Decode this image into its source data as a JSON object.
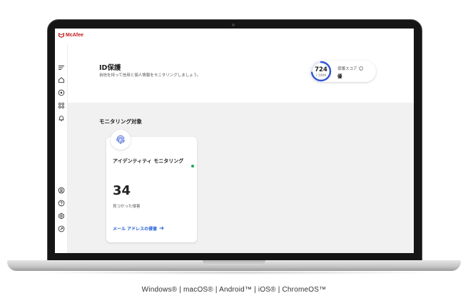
{
  "app": {
    "brand": "McAfee",
    "brand_color": "#c01818"
  },
  "sidebar": {
    "items": [
      {
        "icon": "menu-icon"
      },
      {
        "icon": "home-icon"
      },
      {
        "icon": "scan-icon"
      },
      {
        "icon": "apps-icon"
      },
      {
        "icon": "bell-icon"
      },
      {
        "icon": "account-icon"
      },
      {
        "icon": "help-icon"
      },
      {
        "icon": "settings-icon"
      },
      {
        "icon": "feedback-icon"
      }
    ]
  },
  "header": {
    "title": "ID保護",
    "subtitle": "自信を持って信用と個人情報をモニタリングしましょう。"
  },
  "score": {
    "value": "724",
    "max": "/ 1000",
    "fraction": 0.724,
    "label": "保護スコア",
    "rating": "優",
    "ring_color": "#2f55d4"
  },
  "monitoring": {
    "section_title": "モニタリング対象",
    "card": {
      "icon": "fingerprint-icon",
      "title": "アイデンティティ モニタリング",
      "status_color": "#1fa85e",
      "count": "34",
      "count_label": "見つかった侵害",
      "link_label": "メール アドレスの侵害",
      "link_color": "#1f5bd6"
    }
  },
  "footer": {
    "platforms": "Windows®  |  macOS®  |  Android™  |  iOS® | ChromeOS™"
  }
}
